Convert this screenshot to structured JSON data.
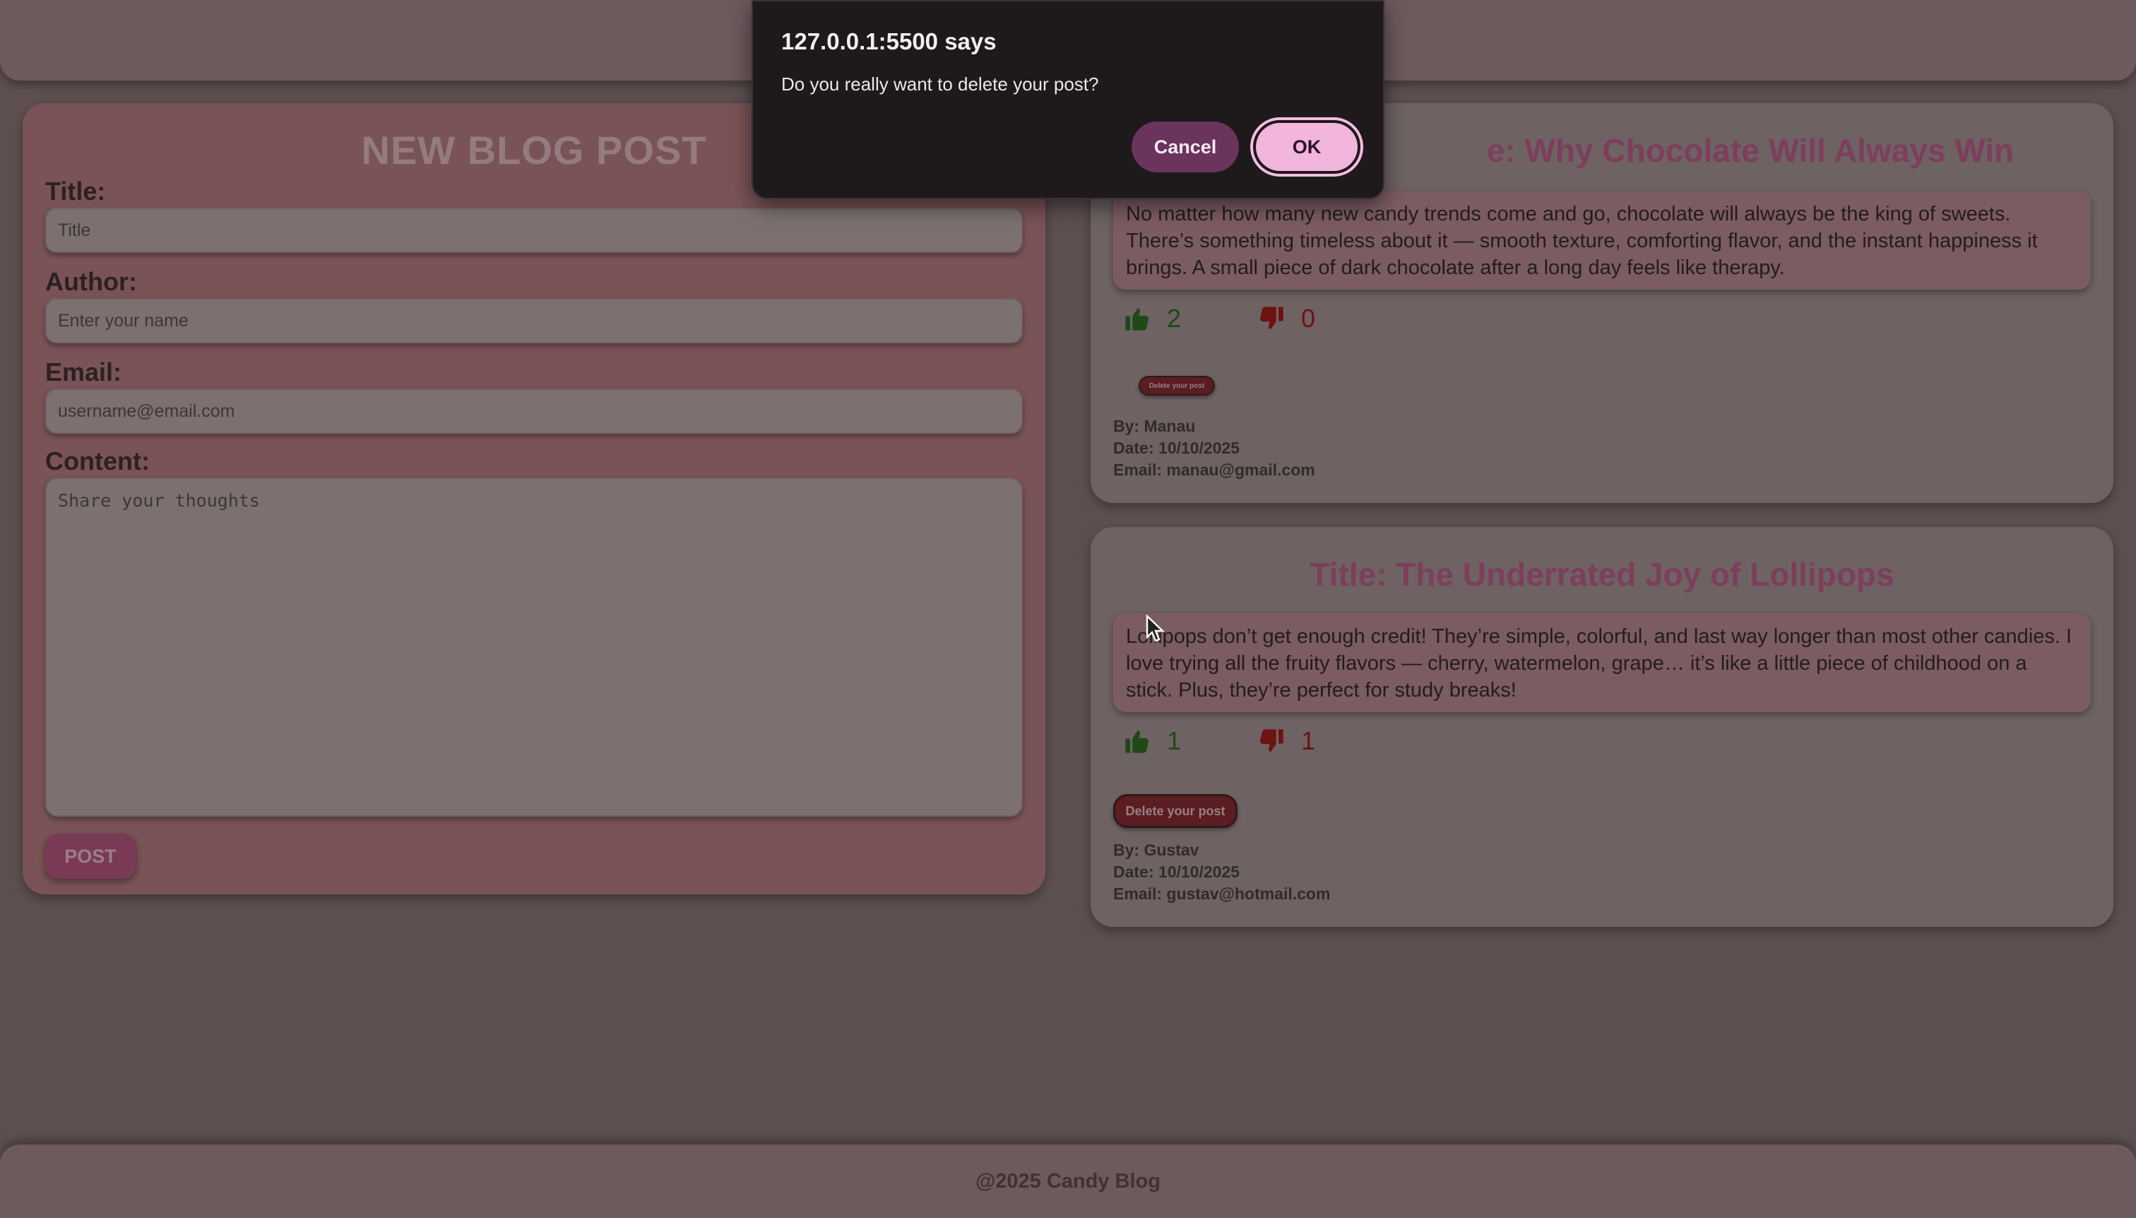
{
  "form": {
    "heading": "NEW BLOG POST",
    "title_label": "Title:",
    "title_placeholder": "Title",
    "author_label": "Author:",
    "author_placeholder": "Enter your name",
    "email_label": "Email:",
    "email_placeholder": "username@email.com",
    "content_label": "Content:",
    "content_placeholder": "Share your thoughts",
    "post_button": "POST"
  },
  "posts": [
    {
      "title": "Title: Why Chocolate Will Always Win",
      "title_visible": "e: Why Chocolate Will Always Win",
      "body": "No matter how many new candy trends come and go, chocolate will always be the king of sweets. There’s something timeless about it — smooth texture, comforting flavor, and the instant happiness it brings. A small piece of dark chocolate after a long day feels like therapy.",
      "likes": "2",
      "dislikes": "0",
      "delete_label": "Delete your post",
      "by": "By: Manau",
      "date": "Date: 10/10/2025",
      "email": "Email: manau@gmail.com"
    },
    {
      "title": "Title: The Underrated Joy of Lollipops",
      "body": "Lollipops don’t get enough credit! They’re simple, colorful, and last way longer than most other candies. I love trying all the fruity flavors — cherry, watermelon, grape… it’s like a little piece of childhood on a stick. Plus, they’re perfect for study breaks!",
      "likes": "1",
      "dislikes": "1",
      "delete_label": "Delete your post",
      "by": "By: Gustav",
      "date": "Date: 10/10/2025",
      "email": "Email: gustav@hotmail.com"
    }
  ],
  "dialog": {
    "title": "127.0.0.1:5500 says",
    "message": "Do you really want to delete your post?",
    "cancel": "Cancel",
    "ok": "OK"
  },
  "footer": {
    "text": "@2025 Candy Blog"
  },
  "icons": {
    "like": "thumbs-up-icon",
    "dislike": "thumbs-down-icon",
    "cursor": "mouse-cursor-icon"
  },
  "colors": {
    "accent_pink": "#f2b5dc",
    "cancel_purple": "#6b345c",
    "like_green": "#1f4a16",
    "dislike_red": "#6e1212"
  }
}
